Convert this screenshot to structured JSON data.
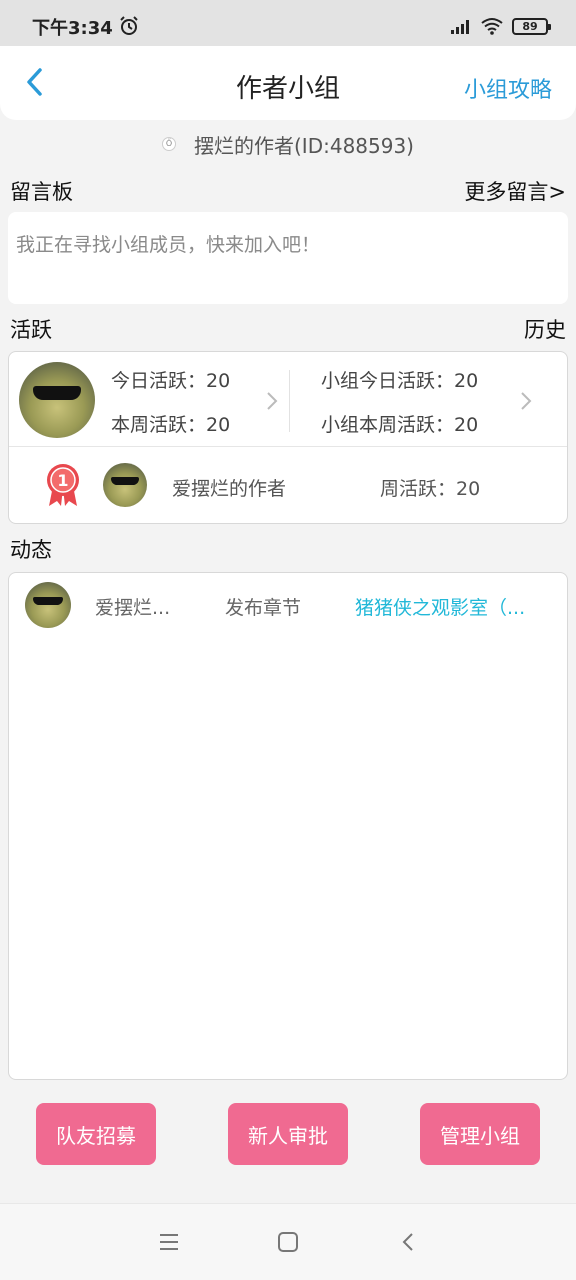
{
  "status_bar": {
    "time": "下午3:34",
    "battery": "89",
    "icons": [
      "alarm-clock-icon",
      "signal-icon",
      "wifi-icon",
      "battery-icon"
    ]
  },
  "header": {
    "title": "作者小组",
    "guide_link": "小组攻略",
    "back_icon": "chevron-left-icon"
  },
  "author_line": "摆烂的作者(ID:488593)",
  "message_board": {
    "title": "留言板",
    "more": "更多留言>",
    "text": "我正在寻找小组成员，快来加入吧！"
  },
  "activity": {
    "title": "活跃",
    "history": "历史",
    "today": "今日活跃：20",
    "week": "本周活跃：20",
    "group_today": "小组今日活跃：20",
    "group_week": "小组本周活跃：20",
    "ranking": {
      "rank": "1",
      "name": "爱摆烂的作者",
      "week_active": "周活跃：20"
    }
  },
  "feed": {
    "title": "动态",
    "items": [
      {
        "user": "爱摆烂...",
        "action": "发布章节",
        "target": "猪猪侠之观影室（..."
      }
    ]
  },
  "buttons": {
    "recruit": "队友招募",
    "approve": "新人审批",
    "manage": "管理小组"
  },
  "colors": {
    "accent_blue": "#2b9bd8",
    "link_cyan": "#22b8d8",
    "button_pink": "#f06a91"
  },
  "nav_icons": [
    "menu-icon",
    "home-square-icon",
    "back-icon"
  ]
}
